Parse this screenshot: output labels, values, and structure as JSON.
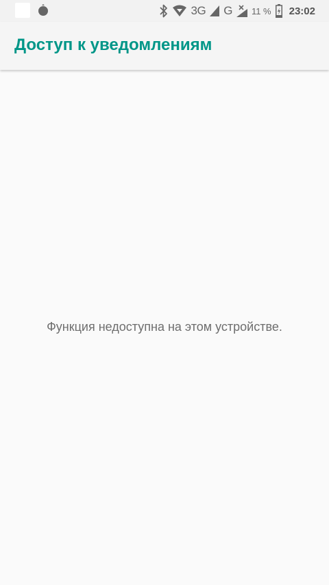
{
  "status_bar": {
    "icons_left": [
      "notification-square-icon",
      "notification-blob-icon"
    ],
    "icons_right": [
      "bluetooth-icon",
      "wifi-icon",
      "cellular-signal-icon",
      "no-signal-icon",
      "battery-icon"
    ],
    "network_3g": "3G",
    "network_g": "G",
    "battery_percent": "11 %",
    "time": "23:02"
  },
  "app_bar": {
    "title": "Доступ к уведомлениям"
  },
  "main": {
    "message": "Функция недоступна на этом устройстве."
  },
  "colors": {
    "accent": "#009688",
    "background": "#fafafa",
    "status_bar": "#f2f2f2",
    "message_text": "#6e6e6e"
  }
}
